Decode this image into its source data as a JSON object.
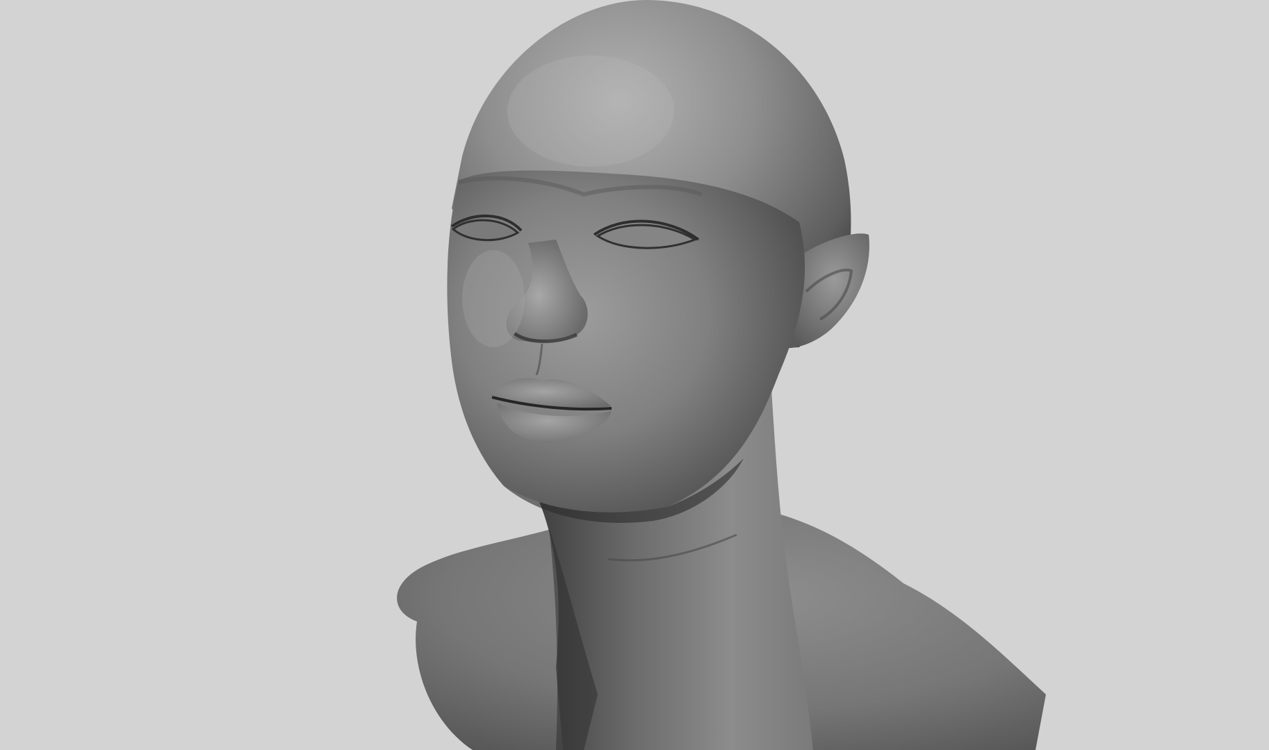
{
  "scene": {
    "subject": "sculpted-head-bust",
    "background_color": "#d3d3d3",
    "surface_color": "#8a8a8a",
    "highlight_color": "#b4b4b4",
    "shadow_color": "#2e2e2e"
  }
}
